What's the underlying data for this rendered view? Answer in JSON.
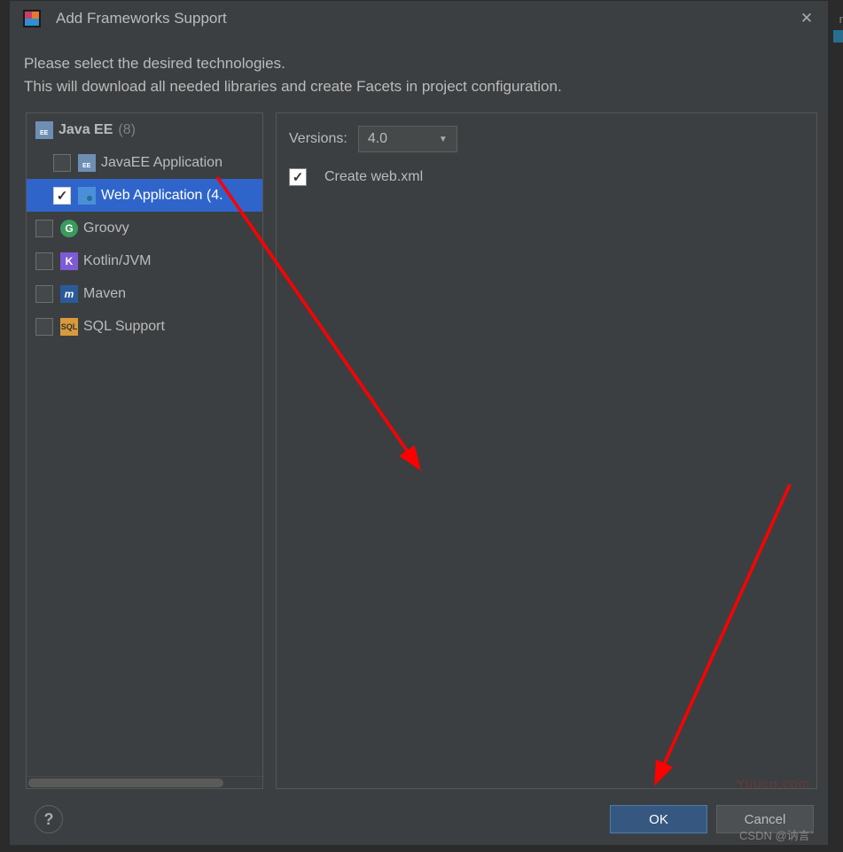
{
  "window": {
    "title": "Add Frameworks Support",
    "description_line1": "Please select the desired technologies.",
    "description_line2": "This will download all needed libraries and create Facets in project configuration."
  },
  "tree": {
    "group": {
      "label": "Java EE",
      "badge": "(8)"
    },
    "items": [
      {
        "label": "JavaEE Application",
        "checked": false,
        "selected": false,
        "icon": "folder-icon"
      },
      {
        "label": "Web Application (4.",
        "checked": true,
        "selected": true,
        "icon": "web-icon"
      }
    ],
    "techs": [
      {
        "label": "Groovy",
        "icon": "groovy-icon",
        "glyph": "G"
      },
      {
        "label": "Kotlin/JVM",
        "icon": "kotlin-icon",
        "glyph": "K"
      },
      {
        "label": "Maven",
        "icon": "maven-icon",
        "glyph": "m"
      },
      {
        "label": "SQL Support",
        "icon": "sql-icon",
        "glyph": "SQL"
      }
    ]
  },
  "right": {
    "versions_label": "Versions:",
    "version_selected": "4.0",
    "create_webxml_label": "Create web.xml",
    "create_webxml_checked": true
  },
  "footer": {
    "ok": "OK",
    "cancel": "Cancel",
    "help": "?"
  },
  "watermark": {
    "csdn": "CSDN @讷言`",
    "site": "Yuucn.com"
  }
}
